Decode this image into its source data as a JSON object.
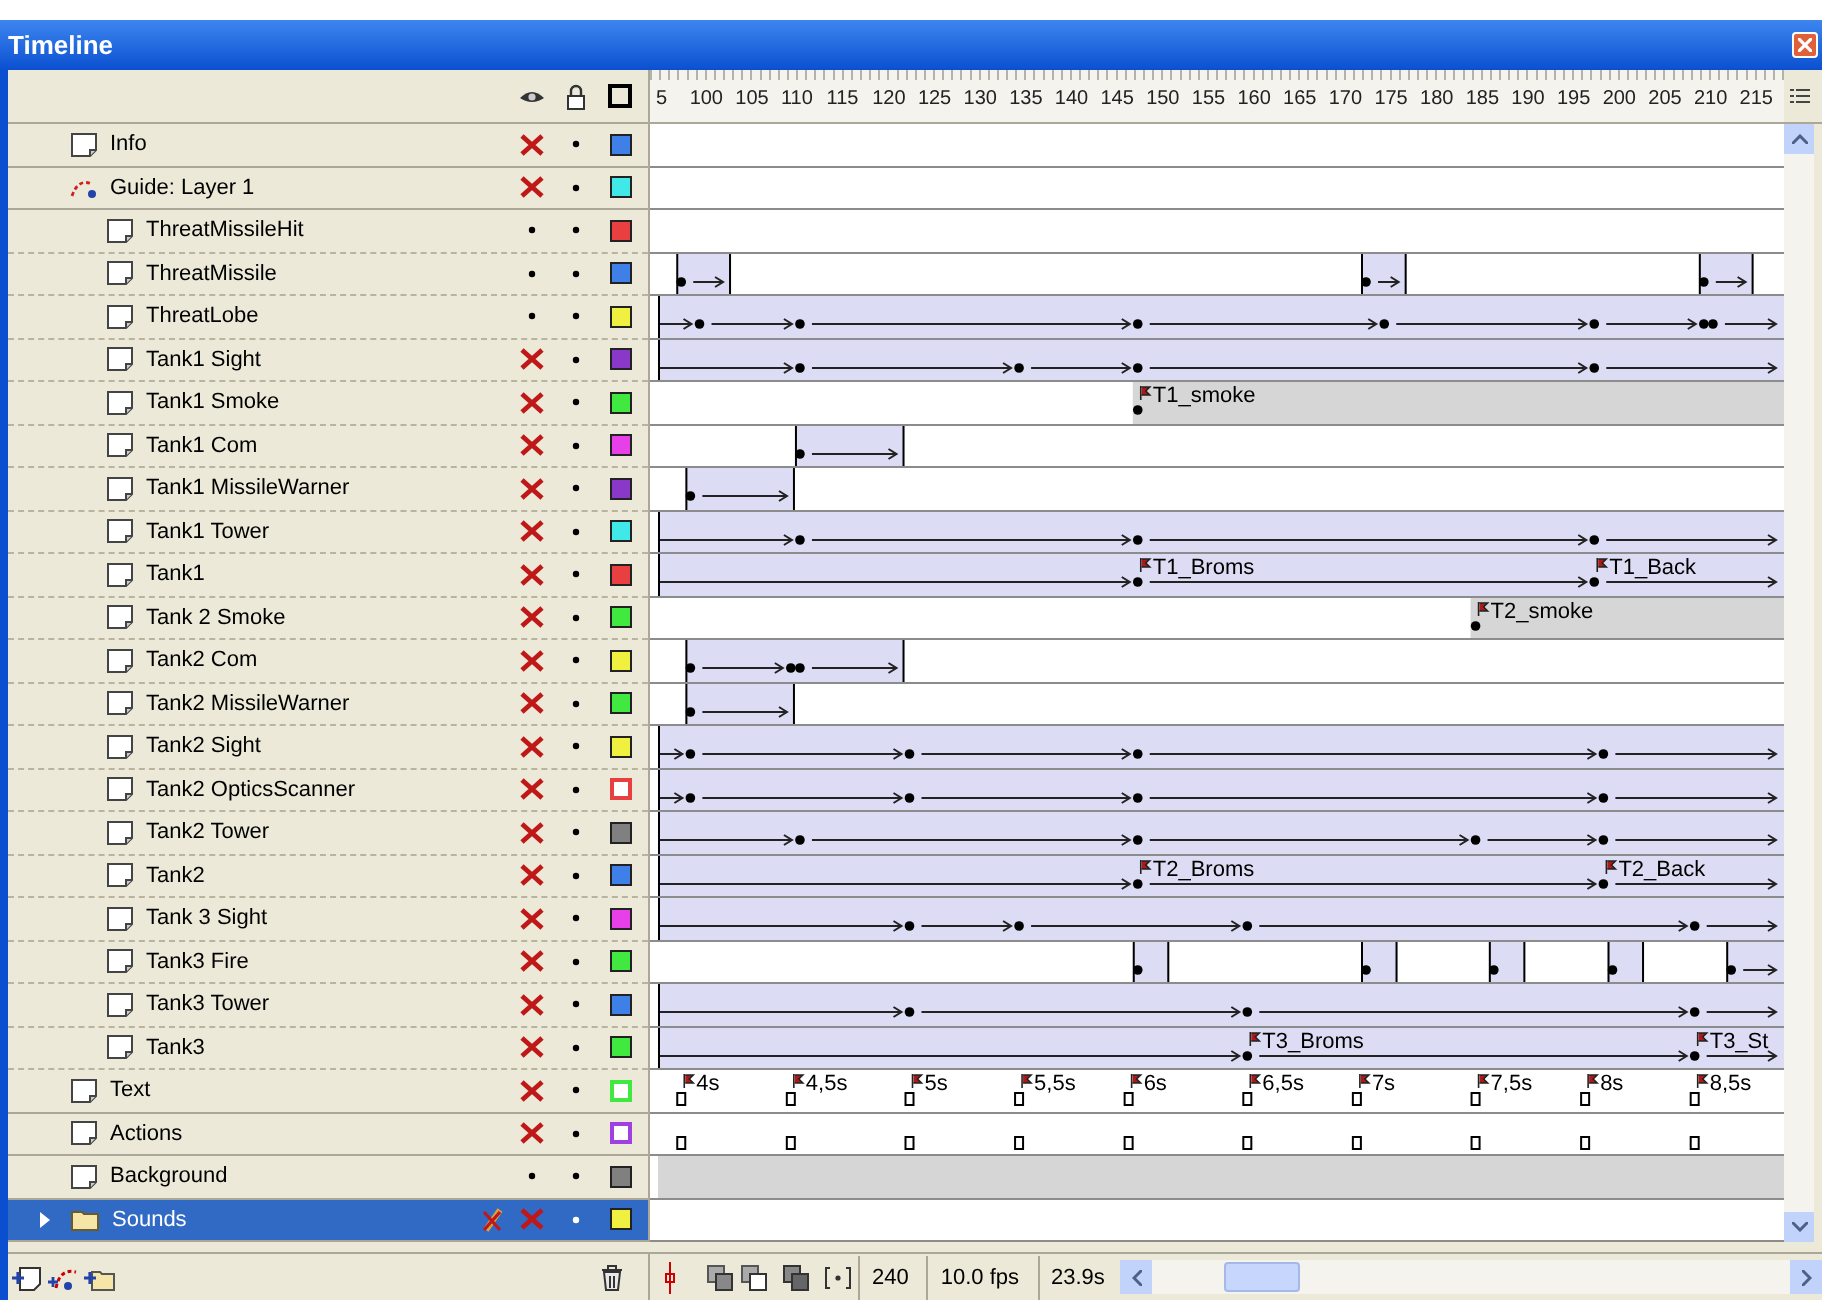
{
  "window": {
    "title": "Timeline"
  },
  "ruler": [
    "5",
    "100",
    "105",
    "110",
    "115",
    "120",
    "125",
    "130",
    "135",
    "140",
    "145",
    "150",
    "155",
    "160",
    "165",
    "170",
    "175",
    "180",
    "185",
    "190",
    "195",
    "200",
    "205",
    "210",
    "215"
  ],
  "layers": [
    {
      "name": "Info",
      "kind": "layer",
      "hidden": true,
      "color": "#3f7fe8",
      "outline": false,
      "selected": false,
      "edit_blocked": false
    },
    {
      "name": "Guide: Layer 1",
      "kind": "guide",
      "hidden": true,
      "color": "#40e8e8",
      "outline": false,
      "selected": false,
      "edit_blocked": false,
      "children": [
        {
          "name": "ThreatMissileHit",
          "kind": "layer",
          "hidden": false,
          "color": "#e84040",
          "outline": false,
          "selected": false,
          "edit_blocked": false
        },
        {
          "name": "ThreatMissile",
          "kind": "layer",
          "hidden": false,
          "color": "#3f7fe8",
          "outline": false,
          "selected": false,
          "edit_blocked": false
        },
        {
          "name": "ThreatLobe",
          "kind": "layer",
          "hidden": false,
          "color": "#f0f040",
          "outline": false,
          "selected": false,
          "edit_blocked": false
        },
        {
          "name": "Tank1 Sight",
          "kind": "layer",
          "hidden": true,
          "color": "#8a38c8",
          "outline": false,
          "selected": false,
          "edit_blocked": false
        },
        {
          "name": "Tank1 Smoke",
          "kind": "layer",
          "hidden": true,
          "color": "#40e840",
          "outline": false,
          "selected": false,
          "edit_blocked": false,
          "labels": [
            "T1_smoke"
          ]
        },
        {
          "name": "Tank1 Com",
          "kind": "layer",
          "hidden": true,
          "color": "#e840e8",
          "outline": false,
          "selected": false,
          "edit_blocked": false
        },
        {
          "name": "Tank1 MissileWarner",
          "kind": "layer",
          "hidden": true,
          "color": "#8a38c8",
          "outline": false,
          "selected": false,
          "edit_blocked": false
        },
        {
          "name": "Tank1 Tower",
          "kind": "layer",
          "hidden": true,
          "color": "#40e8e8",
          "outline": false,
          "selected": false,
          "edit_blocked": false
        },
        {
          "name": "Tank1",
          "kind": "layer",
          "hidden": true,
          "color": "#e84040",
          "outline": false,
          "selected": false,
          "edit_blocked": false,
          "labels": [
            "T1_Broms",
            "T1_Back"
          ]
        },
        {
          "name": "Tank 2 Smoke",
          "kind": "layer",
          "hidden": true,
          "color": "#40e840",
          "outline": false,
          "selected": false,
          "edit_blocked": false,
          "labels": [
            "T2_smoke"
          ]
        },
        {
          "name": "Tank2 Com",
          "kind": "layer",
          "hidden": true,
          "color": "#f0f040",
          "outline": false,
          "selected": false,
          "edit_blocked": false
        },
        {
          "name": "Tank2 MissileWarner",
          "kind": "layer",
          "hidden": true,
          "color": "#40e840",
          "outline": false,
          "selected": false,
          "edit_blocked": false
        },
        {
          "name": "Tank2 Sight",
          "kind": "layer",
          "hidden": true,
          "color": "#f0f040",
          "outline": false,
          "selected": false,
          "edit_blocked": false
        },
        {
          "name": "Tank2 OpticsScanner",
          "kind": "layer",
          "hidden": true,
          "color": "#e84040",
          "outline": true,
          "selected": false,
          "edit_blocked": false
        },
        {
          "name": "Tank2 Tower",
          "kind": "layer",
          "hidden": true,
          "color": "#808080",
          "outline": false,
          "selected": false,
          "edit_blocked": false
        },
        {
          "name": "Tank2",
          "kind": "layer",
          "hidden": true,
          "color": "#3f7fe8",
          "outline": false,
          "selected": false,
          "edit_blocked": false,
          "labels": [
            "T2_Broms",
            "T2_Back"
          ]
        },
        {
          "name": "Tank 3 Sight",
          "kind": "layer",
          "hidden": true,
          "color": "#e840e8",
          "outline": false,
          "selected": false,
          "edit_blocked": false
        },
        {
          "name": "Tank3 Fire",
          "kind": "layer",
          "hidden": true,
          "color": "#40e840",
          "outline": false,
          "selected": false,
          "edit_blocked": false
        },
        {
          "name": "Tank3 Tower",
          "kind": "layer",
          "hidden": true,
          "color": "#3f7fe8",
          "outline": false,
          "selected": false,
          "edit_blocked": false
        },
        {
          "name": "Tank3",
          "kind": "layer",
          "hidden": true,
          "color": "#40e840",
          "outline": false,
          "selected": false,
          "edit_blocked": false,
          "labels": [
            "T3_Broms",
            "T3_St"
          ]
        }
      ]
    },
    {
      "name": "Text",
      "kind": "layer",
      "hidden": true,
      "color": "#40e840",
      "outline": true,
      "selected": false,
      "edit_blocked": false,
      "labels": [
        "4s",
        "4,5s",
        "5s",
        "5,5s",
        "6s",
        "6,5s",
        "7s",
        "7,5s",
        "8s",
        "8,5s"
      ]
    },
    {
      "name": "Actions",
      "kind": "layer",
      "hidden": true,
      "color": "#a040e0",
      "outline": true,
      "selected": false,
      "edit_blocked": false
    },
    {
      "name": "Background",
      "kind": "layer",
      "hidden": false,
      "color": "#808080",
      "outline": false,
      "selected": false,
      "edit_blocked": false
    },
    {
      "name": "Sounds",
      "kind": "folder",
      "expanded": false,
      "hidden": true,
      "color": "#f0f040",
      "outline": false,
      "selected": true,
      "edit_blocked": true
    }
  ],
  "footer": {
    "frame": "240",
    "fps": "10.0 fps",
    "time": "23.9s"
  }
}
